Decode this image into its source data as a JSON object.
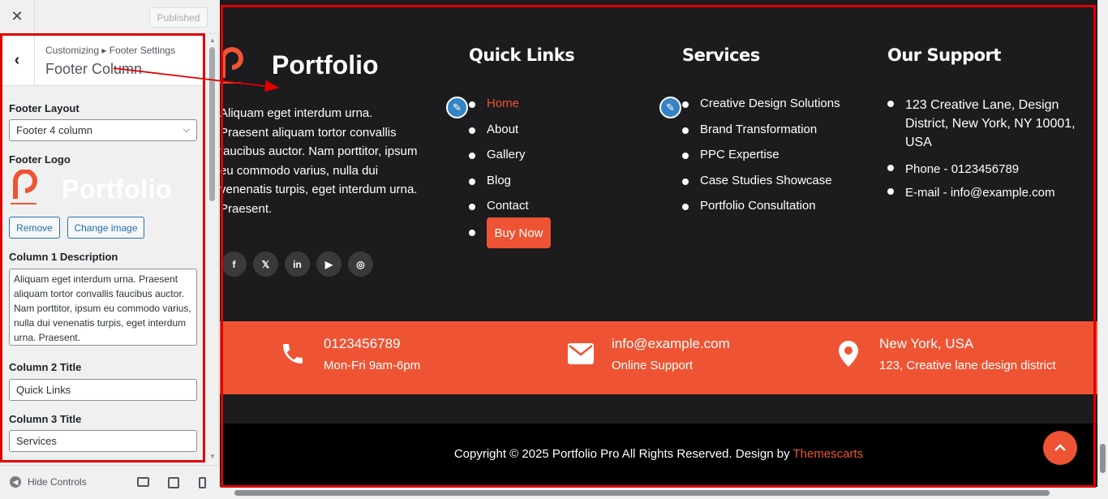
{
  "topbar": {
    "close_label": "✕",
    "published_label": "Published"
  },
  "panel": {
    "breadcrumb": "Customizing ▸ Footer Settings",
    "title": "Footer Column",
    "footer_layout_label": "Footer Layout",
    "footer_layout_value": "Footer 4 column",
    "footer_logo_label": "Footer Logo",
    "logo_text": "Portfolio",
    "remove_label": "Remove",
    "change_image_label": "Change image",
    "col1_desc_label": "Column 1 Description",
    "col1_desc_value": "Aliquam eget interdum urna. Praesent aliquam tortor convallis faucibus auctor. Nam porttitor, ipsum eu commodo varius, nulla dui venenatis turpis, eget interdum urna. Praesent.",
    "col2_title_label": "Column 2 Title",
    "col2_title_value": "Quick Links",
    "col3_title_label": "Column 3 Title",
    "col3_title_value": "Services"
  },
  "bottombar": {
    "hide_controls_label": "Hide Controls"
  },
  "preview": {
    "brand_name": "Portfolio",
    "description": "Aliquam eget interdum urna. Praesent aliquam tortor convallis faucibus auctor. Nam porttitor, ipsum eu commodo varius, nulla dui venenatis turpis, eget interdum urna. Praesent.",
    "social": [
      "f",
      "𝕏",
      "in",
      "▶",
      "◎"
    ],
    "quick_links_title": "Quick Links",
    "quick_links": [
      "Home",
      "About",
      "Gallery",
      "Blog",
      "Contact"
    ],
    "buy_now": "Buy Now",
    "services_title": "Services",
    "services": [
      "Creative Design Solutions",
      "Brand Transformation",
      "PPC Expertise",
      "Case Studies Showcase",
      "Portfolio Consultation"
    ],
    "support_title": "Our Support",
    "support": [
      "123 Creative Lane, Design District, New York, NY 10001, USA",
      "Phone -  0123456789",
      "E-mail - info@example.com"
    ],
    "contact": {
      "phone": "0123456789",
      "phone_sub": "Mon-Fri 9am-6pm",
      "email": "info@example.com",
      "email_sub": "Online Support",
      "location": "New York, USA",
      "location_sub": "123, Creative lane design district"
    },
    "copyright_text": "Copyright © 2025 Portfolio Pro All Rights Reserved. Design by ",
    "copyright_link": "Themescarts"
  },
  "colors": {
    "accent": "#ee5433",
    "footer_bg": "#1c1b1e",
    "wp_blue": "#2271b1",
    "annotation": "#e00000"
  },
  "icons": [
    "close-icon",
    "back-arrow-icon",
    "chevron-down-icon",
    "pencil-icon",
    "phone-icon",
    "envelope-icon",
    "map-pin-icon",
    "arrow-up-icon",
    "desktop-icon",
    "tablet-icon",
    "mobile-icon"
  ]
}
